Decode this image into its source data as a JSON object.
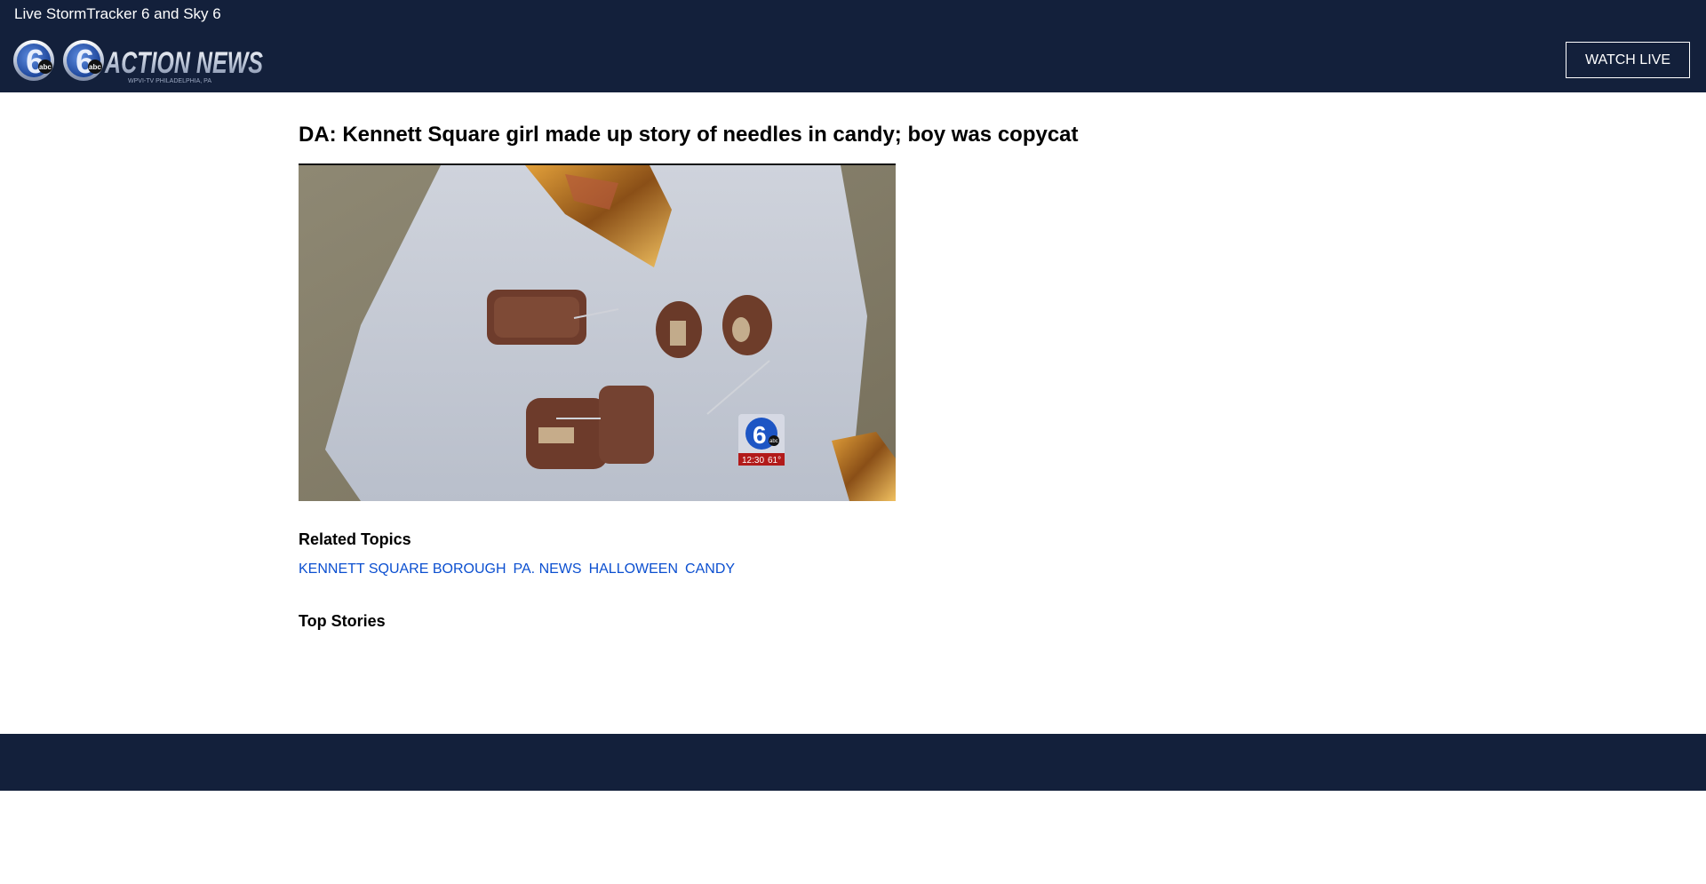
{
  "header": {
    "top_link": "Live StormTracker 6 and Sky 6",
    "logo_text": "ACTION NEWS",
    "logo_sub": "WPVI-TV  PHILADELPHIA, PA",
    "logo_number": "6",
    "logo_abc": "abc",
    "watch_live": "WATCH LIVE"
  },
  "article": {
    "headline": "DA: Kennett Square girl made up story of needles in candy; boy was copycat",
    "image_bug": {
      "number": "6",
      "abc": "abc",
      "time": "12:30",
      "temp": "61°"
    }
  },
  "related_topics": {
    "title": "Related Topics",
    "items": [
      "KENNETT SQUARE BOROUGH",
      "PA. NEWS",
      "HALLOWEEN",
      "CANDY"
    ]
  },
  "top_stories": {
    "title": "Top Stories"
  },
  "colors": {
    "header_bg": "#13203b",
    "link": "#0b4fd0"
  }
}
